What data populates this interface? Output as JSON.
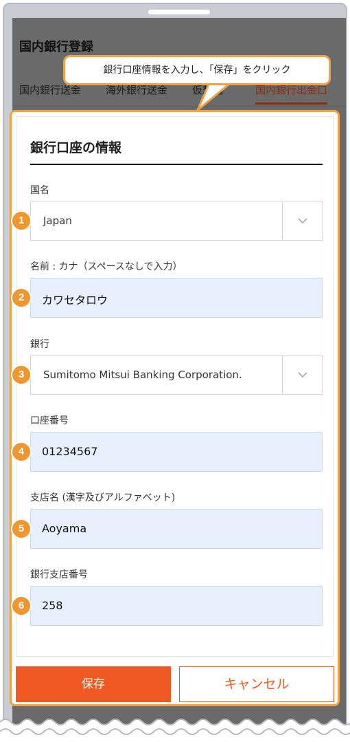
{
  "header": {
    "title": "国内銀行登録"
  },
  "tabs": [
    {
      "label": "国内銀行送金"
    },
    {
      "label": "海外銀行送金"
    },
    {
      "label": "仮想通"
    },
    {
      "label": "国内銀行出金口"
    }
  ],
  "callout": {
    "text": "銀行口座情報を入力し、「保存」をクリック"
  },
  "modal": {
    "title": "銀行口座の情報",
    "fields": [
      {
        "badge": "1",
        "label": "国名",
        "value": "Japan",
        "type": "select"
      },
      {
        "badge": "2",
        "label": "名前 : カナ（スペースなしで入力）",
        "value": "カワセタロウ",
        "type": "input"
      },
      {
        "badge": "3",
        "label": "銀行",
        "value": "Sumitomo Mitsui Banking Corporation.",
        "type": "select"
      },
      {
        "badge": "4",
        "label": "口座番号",
        "value": "01234567",
        "type": "input"
      },
      {
        "badge": "5",
        "label": "支店名 (漢字及びアルファベット)",
        "value": "Aoyama",
        "type": "input"
      },
      {
        "badge": "6",
        "label": "銀行支店番号",
        "value": "258",
        "type": "input"
      }
    ],
    "save_label": "保存",
    "cancel_label": "キャンセル"
  },
  "icons": {
    "select_chevron": "chevron-down-icon",
    "badge": "step-number-badge"
  },
  "colors": {
    "accent_orange": "#f05a22",
    "highlight_border": "#f0a24a",
    "badge_bg": "#f0962e",
    "input_bg": "#e8effd",
    "overlay": "#6a6a6a"
  }
}
